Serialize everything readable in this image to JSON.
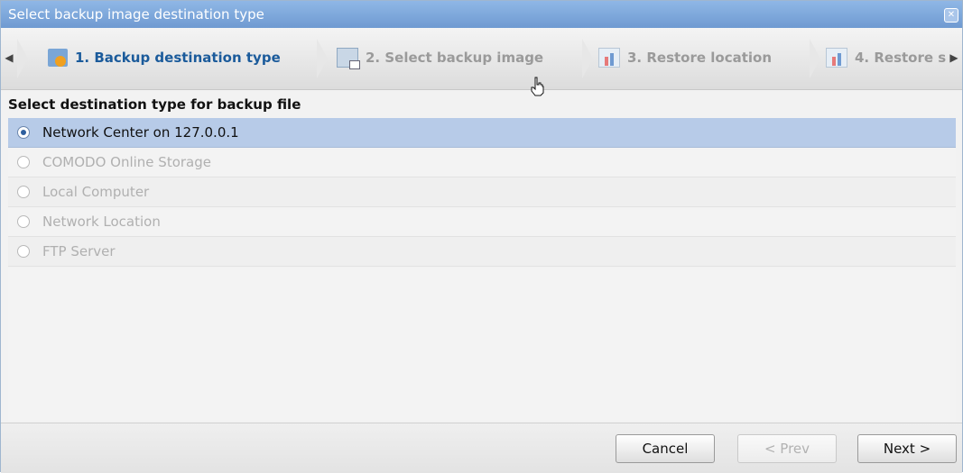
{
  "window": {
    "title": "Select backup image destination type",
    "close_icon": "close-icon"
  },
  "steps": [
    {
      "label": "1. Backup destination type",
      "icon": "restore-folder-icon",
      "state": "active"
    },
    {
      "label": "2. Select backup image",
      "icon": "backup-image-icon",
      "state": "inactive"
    },
    {
      "label": "3. Restore location",
      "icon": "chart-icon",
      "state": "inactive"
    },
    {
      "label": "4. Restore s",
      "icon": "chart-icon",
      "state": "inactive"
    }
  ],
  "content": {
    "title": "Select destination type for backup file",
    "options": [
      {
        "label": "Network Center on 127.0.0.1",
        "selected": true,
        "disabled": false
      },
      {
        "label": "COMODO Online Storage",
        "selected": false,
        "disabled": true
      },
      {
        "label": "Local Computer",
        "selected": false,
        "disabled": true
      },
      {
        "label": "Network Location",
        "selected": false,
        "disabled": true
      },
      {
        "label": "FTP Server",
        "selected": false,
        "disabled": true
      }
    ]
  },
  "footer": {
    "cancel_label": "Cancel",
    "prev_label": "< Prev",
    "next_label": "Next >"
  },
  "colors": {
    "titlebar": "#7aa6dc",
    "selected_row": "#b7cbe8",
    "active_step_text": "#1b5b9b"
  }
}
